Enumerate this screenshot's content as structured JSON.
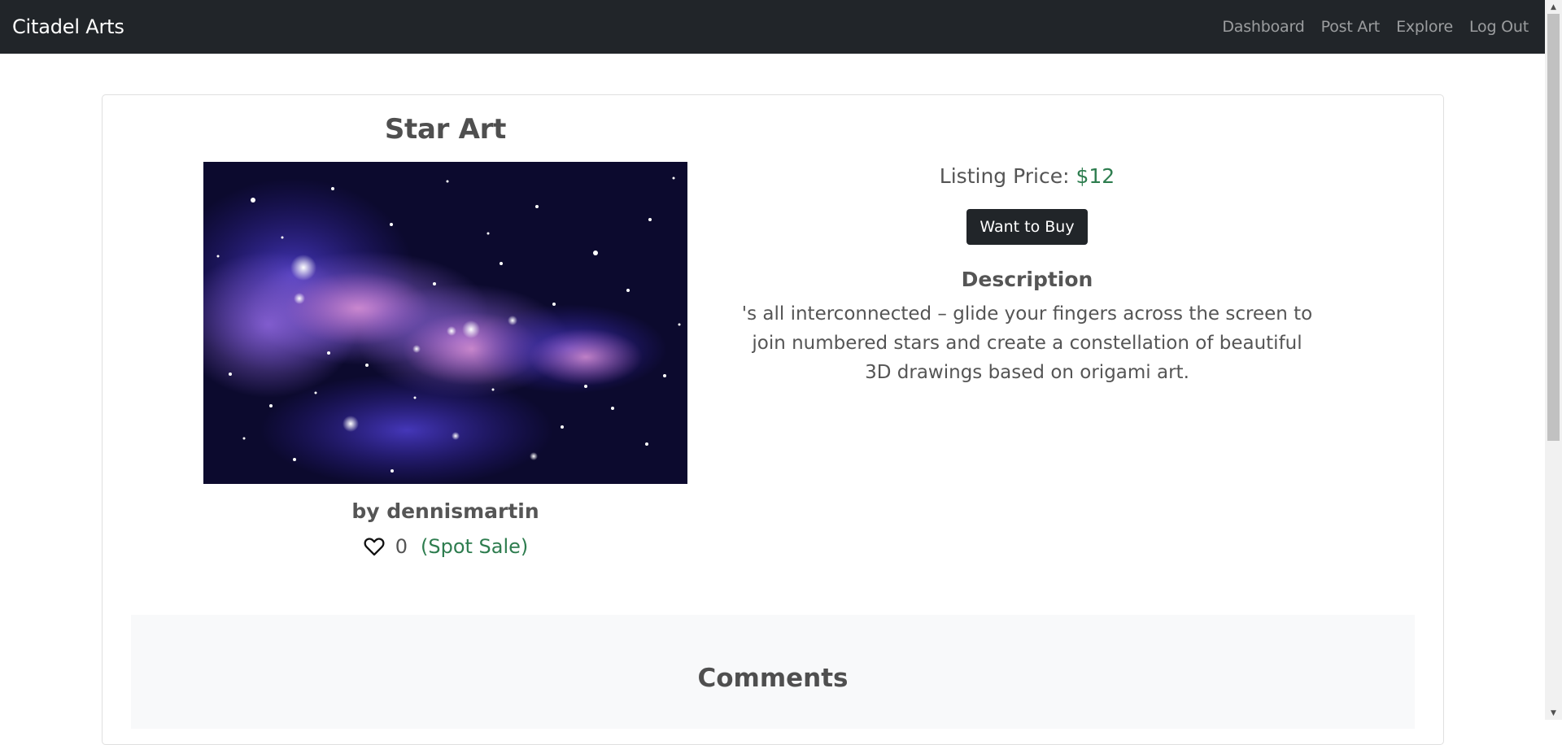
{
  "navbar": {
    "brand": "Citadel Arts",
    "links": [
      "Dashboard",
      "Post Art",
      "Explore",
      "Log Out"
    ]
  },
  "artwork": {
    "title": "Star Art",
    "author": "by dennismartin",
    "likes": "0",
    "sale_type": "(Spot Sale)"
  },
  "listing": {
    "price_label": "Listing Price:",
    "price_value": "$12",
    "buy_button": "Want to Buy",
    "description_heading": "Description",
    "description": "'s all interconnected – glide your fingers across the screen to join numbered stars and create a constellation of beautiful 3D drawings based on origami art."
  },
  "comments": {
    "heading": "Comments"
  },
  "colors": {
    "navbar_bg": "#212529",
    "accent_green": "#2e7d4f",
    "button_bg": "#212529",
    "comments_bg": "#f8f9fa"
  },
  "icons": {
    "like": "heart-outline-icon"
  }
}
